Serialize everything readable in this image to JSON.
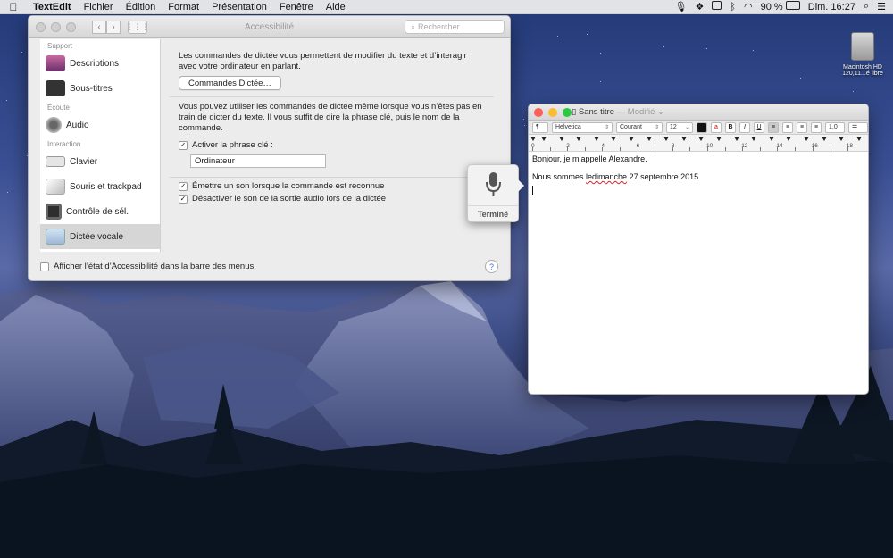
{
  "menubar": {
    "app_name": "TextEdit",
    "items": [
      "Fichier",
      "Édition",
      "Format",
      "Présentation",
      "Fenêtre",
      "Aide"
    ],
    "battery": "90 %",
    "clock": "Dim. 16:27"
  },
  "desktop": {
    "disk_name": "Macintosh HD",
    "disk_info": "120,11...é libre"
  },
  "prefs": {
    "title": "Accessibilité",
    "search_placeholder": "Rechercher",
    "sidebar": {
      "sections": [
        {
          "header": "Support",
          "items": [
            "Descriptions",
            "Sous-titres"
          ]
        },
        {
          "header": "Écoute",
          "items": [
            "Audio"
          ]
        },
        {
          "header": "Interaction",
          "items": [
            "Clavier",
            "Souris et trackpad",
            "Contrôle de sél.",
            "Dictée vocale"
          ]
        }
      ],
      "selected": "Dictée vocale"
    },
    "content": {
      "intro": "Les commandes de dictée vous permettent de modifier du texte et d’interagir avec votre ordinateur en parlant.",
      "commands_button": "Commandes Dictée…",
      "keyphrase_text": "Vous pouvez utiliser les commandes de dictée même lorsque vous n’êtes pas en train de dicter du texte. Il vous suffit de dire la phrase clé, puis le nom de la commande.",
      "keyphrase_checkbox": "Activer la phrase clé :",
      "keyphrase_checked": true,
      "keyphrase_value": "Ordinateur",
      "sound_checkbox": "Émettre un son lorsque la commande est reconnue",
      "sound_checked": true,
      "mute_checkbox": "Désactiver le son de la sortie audio lors de la dictée",
      "mute_checked": true
    },
    "footer_checkbox": "Afficher l’état d’Accessibilité dans la barre des menus",
    "footer_checked": false,
    "help": "?"
  },
  "dictation": {
    "done_label": "Terminé"
  },
  "textedit": {
    "title": "Sans titre",
    "status": "— Modifié",
    "format": {
      "paragraph": "¶",
      "font": "Helvetica",
      "style": "Courant",
      "size": "12",
      "bold": "B",
      "italic": "I",
      "underline": "U",
      "spacing": "1,0"
    },
    "ruler_numbers": [
      "0",
      "2",
      "4",
      "6",
      "8",
      "10",
      "12",
      "14",
      "16",
      "18"
    ],
    "lines": [
      "Bonjour, je m’appelle Alexandre.",
      "Nous sommes ",
      "ledimanche",
      " 27 septembre 2015"
    ]
  }
}
